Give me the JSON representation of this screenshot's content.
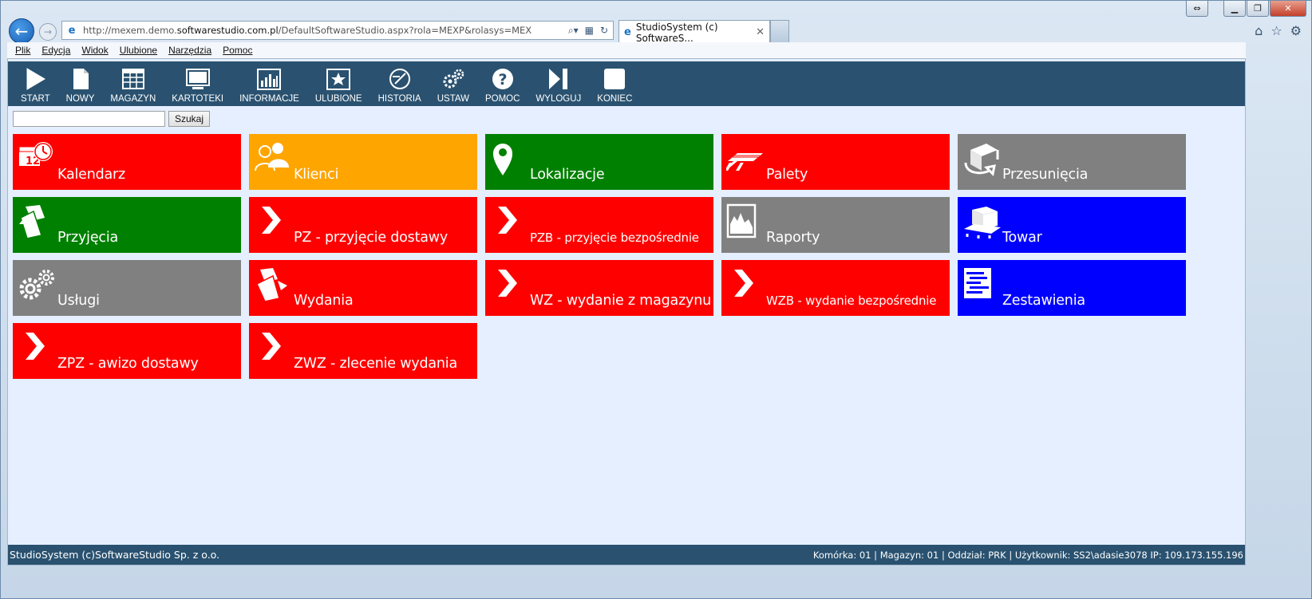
{
  "browser": {
    "url_prefix": "http://mexem.demo.",
    "url_domain": "softwarestudio.com.pl",
    "url_path": "/DefaultSoftwareStudio.aspx?rola=MEXP&rolasys=MEX",
    "tab_title": "StudioSystem (c) SoftwareS...",
    "menu": [
      "Plik",
      "Edycja",
      "Widok",
      "Ulubione",
      "Narzędzia",
      "Pomoc"
    ]
  },
  "toolbar": [
    {
      "label": "START",
      "icon": "play-icon"
    },
    {
      "label": "NOWY",
      "icon": "new-document-icon"
    },
    {
      "label": "MAGAZYN",
      "icon": "warehouse-icon"
    },
    {
      "label": "KARTOTEKI",
      "icon": "monitor-icon"
    },
    {
      "label": "INFORMACJE",
      "icon": "bar-chart-icon"
    },
    {
      "label": "ULUBIONE",
      "icon": "star-icon"
    },
    {
      "label": "HISTORIA",
      "icon": "history-icon"
    },
    {
      "label": "USTAW",
      "icon": "gears-icon"
    },
    {
      "label": "POMOC",
      "icon": "help-icon"
    },
    {
      "label": "WYLOGUJ",
      "icon": "logout-icon"
    },
    {
      "label": "KONIEC",
      "icon": "end-square-icon"
    }
  ],
  "search": {
    "placeholder": "",
    "button": "Szukaj"
  },
  "colors": {
    "red": "#ff0000",
    "orange": "#ffa500",
    "green": "#008000",
    "gray": "#808080",
    "blue": "#0000ff",
    "bar": "#2a5270",
    "bg": "#e5efff"
  },
  "tiles": [
    {
      "label": "Kalendarz",
      "color": "red",
      "icon": "calendar-clock-icon"
    },
    {
      "label": "Klienci",
      "color": "orange",
      "icon": "clients-icon"
    },
    {
      "label": "Lokalizacje",
      "color": "green",
      "icon": "location-pin-icon"
    },
    {
      "label": "Palety",
      "color": "red",
      "icon": "pallet-icon"
    },
    {
      "label": "Przesunięcia",
      "color": "gray",
      "icon": "transfer-icon"
    },
    {
      "label": "Przyjęcia",
      "color": "green",
      "icon": "receipt-icon"
    },
    {
      "label": "PZ - przyjęcie dostawy",
      "color": "red",
      "icon": "chevron-right-icon"
    },
    {
      "label": "PZB - przyjęcie bezpośrednie",
      "color": "red",
      "icon": "chevron-right-icon"
    },
    {
      "label": "Raporty",
      "color": "gray",
      "icon": "report-icon"
    },
    {
      "label": "Towar",
      "color": "blue",
      "icon": "goods-icon"
    },
    {
      "label": "Usługi",
      "color": "gray",
      "icon": "gears-icon"
    },
    {
      "label": "Wydania",
      "color": "red",
      "icon": "issue-icon"
    },
    {
      "label": "WZ - wydanie z magazynu",
      "color": "red",
      "icon": "chevron-right-icon"
    },
    {
      "label": "WZB - wydanie bezpośrednie",
      "color": "red",
      "icon": "chevron-right-icon"
    },
    {
      "label": "Zestawienia",
      "color": "blue",
      "icon": "summary-icon"
    },
    {
      "label": "ZPZ - awizo dostawy",
      "color": "red",
      "icon": "chevron-right-icon"
    },
    {
      "label": "ZWZ - zlecenie wydania",
      "color": "red",
      "icon": "chevron-right-icon"
    }
  ],
  "status": {
    "left": "StudioSystem (c)SoftwareStudio Sp. z o.o.",
    "right": "Komórka: 01 | Magazyn: 01 | Oddział: PRK | Użytkownik: SS2\\adasie3078 IP: 109.173.155.196"
  }
}
